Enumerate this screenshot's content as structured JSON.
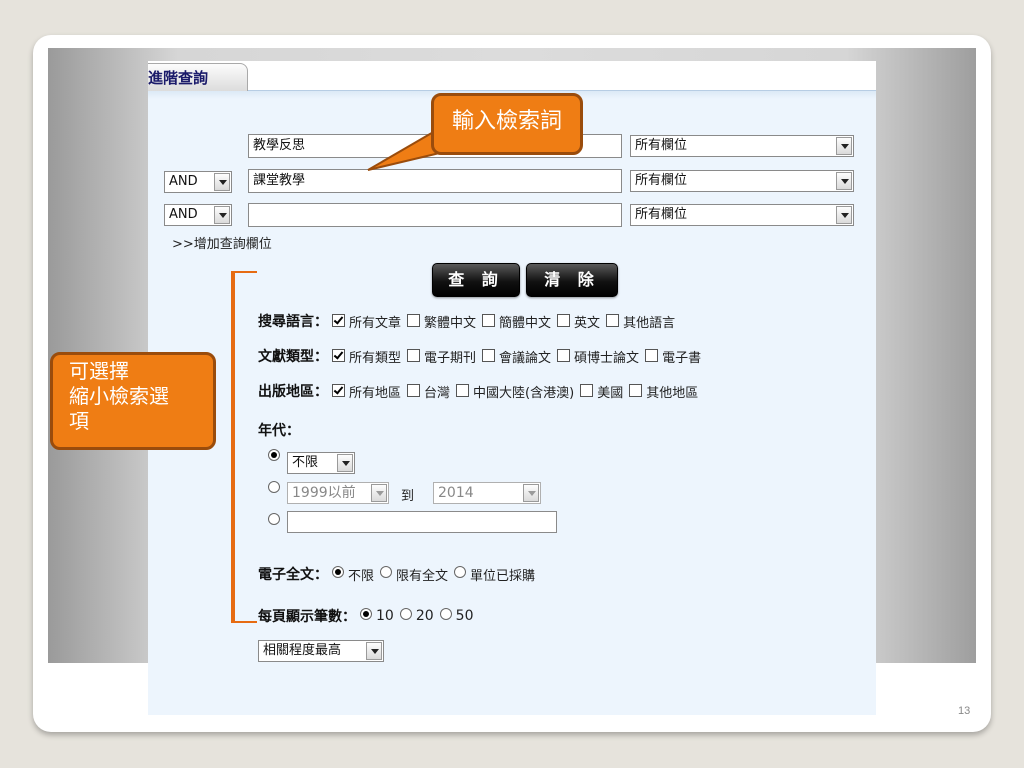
{
  "tab": {
    "label": "進階查詢"
  },
  "search_rows": [
    {
      "operator": null,
      "term": "教學反思",
      "field": "所有欄位"
    },
    {
      "operator": "AND",
      "term": "課堂教學",
      "field": "所有欄位"
    },
    {
      "operator": "AND",
      "term": "",
      "field": "所有欄位"
    }
  ],
  "add_field_link": ">>增加查詢欄位",
  "buttons": {
    "search": "查 詢",
    "clear": "清 除"
  },
  "language": {
    "label": "搜尋語言：",
    "options": [
      {
        "text": "所有文章",
        "checked": true
      },
      {
        "text": "繁體中文",
        "checked": false
      },
      {
        "text": "簡體中文",
        "checked": false
      },
      {
        "text": "英文",
        "checked": false
      },
      {
        "text": "其他語言",
        "checked": false
      }
    ]
  },
  "doc_type": {
    "label": "文獻類型：",
    "options": [
      {
        "text": "所有類型",
        "checked": true
      },
      {
        "text": "電子期刊",
        "checked": false
      },
      {
        "text": "會議論文",
        "checked": false
      },
      {
        "text": "碩博士論文",
        "checked": false
      },
      {
        "text": "電子書",
        "checked": false
      }
    ]
  },
  "region": {
    "label": "出版地區：",
    "options": [
      {
        "text": "所有地區",
        "checked": true
      },
      {
        "text": "台灣",
        "checked": false
      },
      {
        "text": "中國大陸(含港澳)",
        "checked": false
      },
      {
        "text": "美國",
        "checked": false
      },
      {
        "text": "其他地區",
        "checked": false
      }
    ]
  },
  "year": {
    "label": "年代：",
    "unlimited_value": "不限",
    "from_value": "1999以前",
    "to_label": "到",
    "to_value": "2014",
    "custom_value": ""
  },
  "fulltext": {
    "label": "電子全文：",
    "options": [
      {
        "text": "不限",
        "checked": true
      },
      {
        "text": "限有全文",
        "checked": false
      },
      {
        "text": "單位已採購",
        "checked": false
      }
    ]
  },
  "per_page": {
    "label": "每頁顯示筆數：",
    "options": [
      {
        "text": "10",
        "checked": true
      },
      {
        "text": "20",
        "checked": false
      },
      {
        "text": "50",
        "checked": false
      }
    ]
  },
  "sort": {
    "value": "相關程度最高"
  },
  "callouts": {
    "input_terms": "輸入檢索詞",
    "narrow_options": "可選擇\n縮小檢索選\n項"
  },
  "page_number": "13",
  "colors": {
    "callout_fill": "#ef7d14",
    "callout_border": "#9a4c0c",
    "panel_bg": "#edf5fd"
  }
}
